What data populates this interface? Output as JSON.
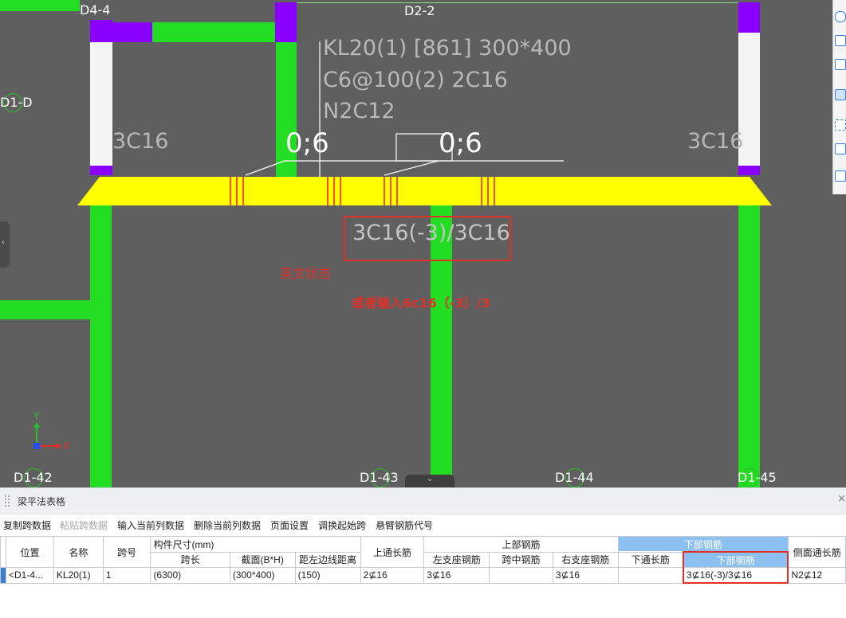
{
  "canvas": {
    "axis_labels": {
      "top_left": "D4-4",
      "top_mid": "D2-2",
      "left": "D1-D",
      "bottom1": "D1-42",
      "bottom2": "D1-43",
      "bottom3": "D1-44",
      "bottom4": "D1-45"
    },
    "beam_annotation": {
      "line1": "KL20(1) [861] 300*400",
      "line2": "C6@100(2) 2C16",
      "line3": "N2C12"
    },
    "support_left": "3C16",
    "support_right": "3C16",
    "dim_left": "0;6",
    "dim_right": "0;6",
    "bottom_rebar_label": "3C16(-3)/3C16",
    "note_english_state": "英文状态",
    "note_or_input": "或者输入6c16（-3）/3",
    "coord_y": "Y",
    "coord_x": "X",
    "colors": {
      "background": "#5f5f5f",
      "column_green": "#22dd22",
      "column_purple": "#8a00ff",
      "beam_yellow": "#ffff00",
      "annotation_red": "#e0302a"
    }
  },
  "panel": {
    "title": "梁平法表格",
    "close": "×",
    "toolbar": {
      "copy": "复制跨数据",
      "paste": "粘贴跨数据",
      "input_col": "输入当前列数据",
      "delete_col": "删除当前列数据",
      "page_setup": "页面设置",
      "swap_span": "调换起始跨",
      "cantilever": "悬臂钢筋代号"
    },
    "table": {
      "headers": {
        "position": "位置",
        "name": "名称",
        "span_no": "跨号",
        "member_size": "构件尺寸(mm)",
        "span_length": "跨长",
        "section": "截面(B*H)",
        "edge_dist": "距左边线距离",
        "top_continuous": "上通长筋",
        "top_rebar": "上部钢筋",
        "left_support": "左支座钢筋",
        "mid_span": "跨中钢筋",
        "right_support": "右支座钢筋",
        "bottom_rebar_group": "下部钢筋",
        "bottom_continuous": "下通长筋",
        "bottom_rebar": "下部钢筋",
        "side_continuous": "侧面通长筋"
      },
      "row": {
        "position": "<D1-4...",
        "name": "KL20(1)",
        "span_no": "1",
        "span_length": "(6300)",
        "section": "(300*400)",
        "edge_dist": "(150)",
        "top_continuous": "2⊈16",
        "left_support": "3⊈16",
        "mid_span": "",
        "right_support": "3⊈16",
        "bottom_continuous": "",
        "bottom_rebar": "3⊈16(-3)/3⊈16",
        "side_continuous": "N2⊈12"
      }
    }
  }
}
